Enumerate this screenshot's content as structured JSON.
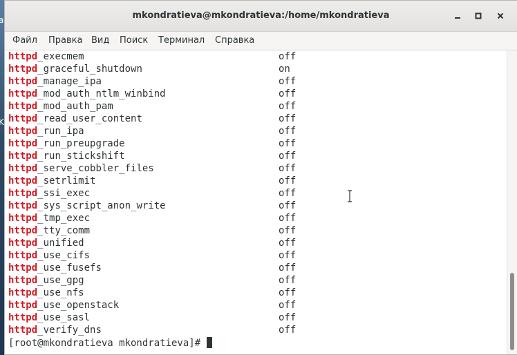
{
  "window": {
    "title": "mkondratieva@mkondratieva:/home/mkondratieva"
  },
  "desktop": {
    "glyphs": [
      "a",
      "K"
    ]
  },
  "menu": [
    "Файл",
    "Правка",
    "Вид",
    "Поиск",
    "Терминал",
    "Справка"
  ],
  "terminal": {
    "prefix": "httpd",
    "rows": [
      {
        "name": "_execmem",
        "value": "off"
      },
      {
        "name": "_graceful_shutdown",
        "value": "on"
      },
      {
        "name": "_manage_ipa",
        "value": "off"
      },
      {
        "name": "_mod_auth_ntlm_winbind",
        "value": "off"
      },
      {
        "name": "_mod_auth_pam",
        "value": "off"
      },
      {
        "name": "_read_user_content",
        "value": "off"
      },
      {
        "name": "_run_ipa",
        "value": "off"
      },
      {
        "name": "_run_preupgrade",
        "value": "off"
      },
      {
        "name": "_run_stickshift",
        "value": "off"
      },
      {
        "name": "_serve_cobbler_files",
        "value": "off"
      },
      {
        "name": "_setrlimit",
        "value": "off"
      },
      {
        "name": "_ssi_exec",
        "value": "off"
      },
      {
        "name": "_sys_script_anon_write",
        "value": "off"
      },
      {
        "name": "_tmp_exec",
        "value": "off"
      },
      {
        "name": "_tty_comm",
        "value": "off"
      },
      {
        "name": "_unified",
        "value": "off"
      },
      {
        "name": "_use_cifs",
        "value": "off"
      },
      {
        "name": "_use_fusefs",
        "value": "off"
      },
      {
        "name": "_use_gpg",
        "value": "off"
      },
      {
        "name": "_use_nfs",
        "value": "off"
      },
      {
        "name": "_use_openstack",
        "value": "off"
      },
      {
        "name": "_use_sasl",
        "value": "off"
      },
      {
        "name": "_verify_dns",
        "value": "off"
      }
    ],
    "prompt": "[root@mkondratieva mkondratieva]# "
  },
  "icons": {
    "minimize": "minimize-icon",
    "maximize": "maximize-icon",
    "close": "close-icon"
  },
  "colors": {
    "highlight": "#d01b24",
    "text": "#2e3436"
  }
}
